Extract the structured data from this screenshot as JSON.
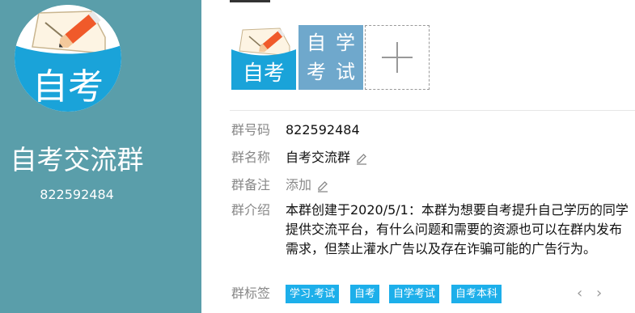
{
  "profile": {
    "avatar_text": "自考",
    "group_name": "自考交流群",
    "group_number": "822592484"
  },
  "group_icons": [
    {
      "name": "自考",
      "icon": "notebook-pencil-icon",
      "color": "#1aa3d9"
    },
    {
      "name": "自学考试",
      "chars": [
        "自",
        "学",
        "考",
        "试"
      ],
      "color": "#6fa8cc"
    },
    {
      "name": "add",
      "icon": "plus-icon"
    }
  ],
  "details": {
    "number": {
      "label": "群号码",
      "value": "822592484"
    },
    "name": {
      "label": "群名称",
      "value": "自考交流群"
    },
    "remark": {
      "label": "群备注",
      "value": "添加"
    },
    "intro": {
      "label": "群介绍",
      "value": "本群创建于2020/5/1：本群为想要自考提升自己学历的同学提供交流平台，有什么问题和需要的资源也可以在群内发布需求，但禁止灌水广告以及存在诈骗可能的广告行为。"
    },
    "tags": {
      "label": "群标签",
      "items": [
        "学习.考试",
        "自考",
        "自学考试",
        "自考本科"
      ]
    }
  },
  "nav": {
    "prev": "‹",
    "next": "›"
  },
  "colors": {
    "left_panel": "#5a9eaa",
    "tag_bg": "#1dafea",
    "label_gray": "#888888"
  }
}
